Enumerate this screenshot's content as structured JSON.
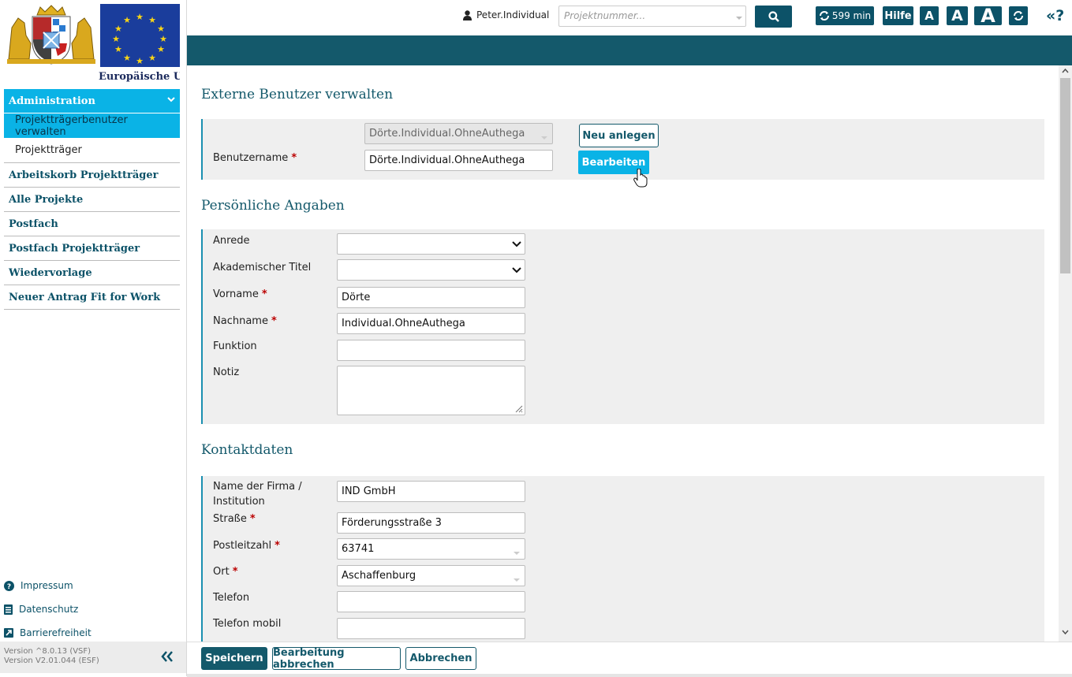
{
  "sidebar": {
    "eu_text": "Europäische Uni",
    "nav_admin": "Administration",
    "nav_sub_active": "Projektträgerbenutzer verwalten",
    "nav_sub": "Projektträger",
    "nav_items": [
      "Arbeitskorb Projektträger",
      "Alle Projekte",
      "Postfach",
      "Postfach Projektträger",
      "Wiedervorlage",
      "Neuer Antrag Fit for Work"
    ],
    "links": [
      "Impressum",
      "Datenschutz",
      "Barrierefreiheit"
    ],
    "version_1": "Version ^8.0.13 (VSF)",
    "version_2": "Version V2.01.044 (ESF)"
  },
  "topbar": {
    "user": "Peter.Individual",
    "project_placeholder": "Projektnummer...",
    "timer": "599 min",
    "help": "Hilfe",
    "font_small": "A",
    "font_medium": "A",
    "font_large": "A",
    "help_icon": "«?"
  },
  "main": {
    "title": "Externe Benutzer verwalten",
    "user_select": "Dörte.Individual.OhneAuthega",
    "username_label": "Benutzername",
    "username_value": "Dörte.Individual.OhneAuthega",
    "new_button": "Neu anlegen",
    "edit_button": "Bearbeiten",
    "personal_title": "Persönliche Angaben",
    "anrede_label": "Anrede",
    "anrede_value": "",
    "titel_label": "Akademischer Titel",
    "titel_value": "",
    "vorname_label": "Vorname",
    "vorname_value": "Dörte",
    "nachname_label": "Nachname",
    "nachname_value": "Individual.OhneAuthega",
    "funktion_label": "Funktion",
    "funktion_value": "",
    "notiz_label": "Notiz",
    "contact_title": "Kontaktdaten",
    "firma_label_1": "Name der Firma /",
    "firma_label_2": "Institution",
    "firma_value": "IND GmbH",
    "strasse_label": "Straße",
    "strasse_value": "Förderungsstraße 3",
    "plz_label": "Postleitzahl",
    "plz_value": "63741",
    "ort_label": "Ort",
    "ort_value": "Aschaffenburg",
    "telefon_label": "Telefon",
    "telefon_value": "",
    "mobil_label": "Telefon mobil",
    "mobil_value": "",
    "required_mark": "*"
  },
  "bottombar": {
    "save": "Speichern",
    "cancel_edit": "Bearbeitung abbrechen",
    "cancel": "Abbrechen"
  },
  "colors": {
    "teal": "#14596b",
    "cyan": "#0ab3e6",
    "required": "#b00000"
  }
}
